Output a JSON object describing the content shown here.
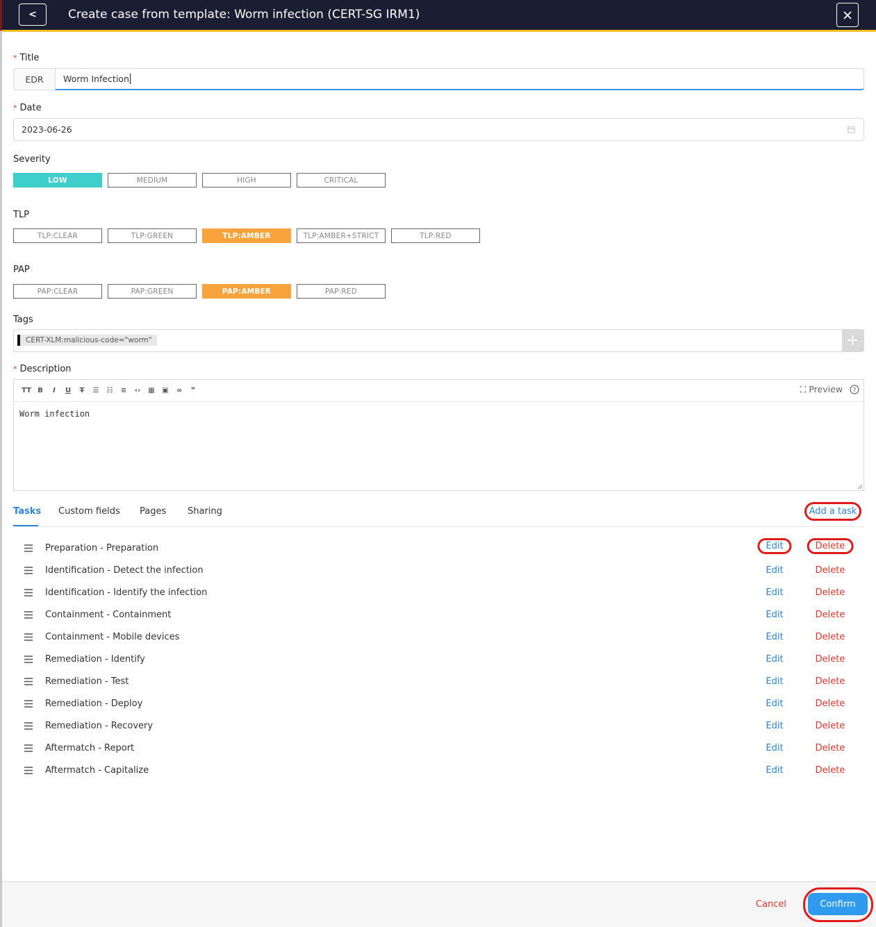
{
  "header": {
    "back_label": "<",
    "title": "Create case from template: Worm infection (CERT-SG IRM1)"
  },
  "form": {
    "title_label": "Title",
    "title_prefix": "EDR",
    "title_value": "Worm Infection",
    "date_label": "Date",
    "date_value": "2023-06-26",
    "severity_label": "Severity",
    "severity_options": [
      "LOW",
      "MEDIUM",
      "HIGH",
      "CRITICAL"
    ],
    "severity_selected": "LOW",
    "tlp_label": "TLP",
    "tlp_options": [
      "TLP:CLEAR",
      "TLP:GREEN",
      "TLP:AMBER",
      "TLP:AMBER+STRICT",
      "TLP:RED"
    ],
    "tlp_selected": "TLP:AMBER",
    "pap_label": "PAP",
    "pap_options": [
      "PAP:CLEAR",
      "PAP:GREEN",
      "PAP:AMBER",
      "PAP:RED"
    ],
    "pap_selected": "PAP:AMBER",
    "tags_label": "Tags",
    "tags": [
      "CERT-XLM:malicious-code=\"worm\""
    ],
    "description_label": "Description",
    "description_value": "Worm infection",
    "preview_label": "Preview"
  },
  "tabs": {
    "items": [
      "Tasks",
      "Custom fields",
      "Pages",
      "Sharing"
    ],
    "active": "Tasks",
    "add_task_label": "Add a task"
  },
  "tasks": {
    "edit_label": "Edit",
    "delete_label": "Delete",
    "items": [
      "Preparation - Preparation",
      "Identification - Detect the infection",
      "Identification - Identify the infection",
      "Containment - Containment",
      "Containment - Mobile devices",
      "Remediation - Identify",
      "Remediation - Test",
      "Remediation - Deploy",
      "Remediation - Recovery",
      "Aftermatch - Report",
      "Aftermatch - Capitalize"
    ]
  },
  "footer": {
    "cancel_label": "Cancel",
    "confirm_label": "Confirm"
  },
  "colors": {
    "header_bg": "#1b1d33",
    "accent_blue": "#2e84d6",
    "severity_low": "#3ecfcc",
    "amber": "#f8a33c",
    "danger": "#e0352b",
    "annotation_red": "#e11b1b"
  }
}
